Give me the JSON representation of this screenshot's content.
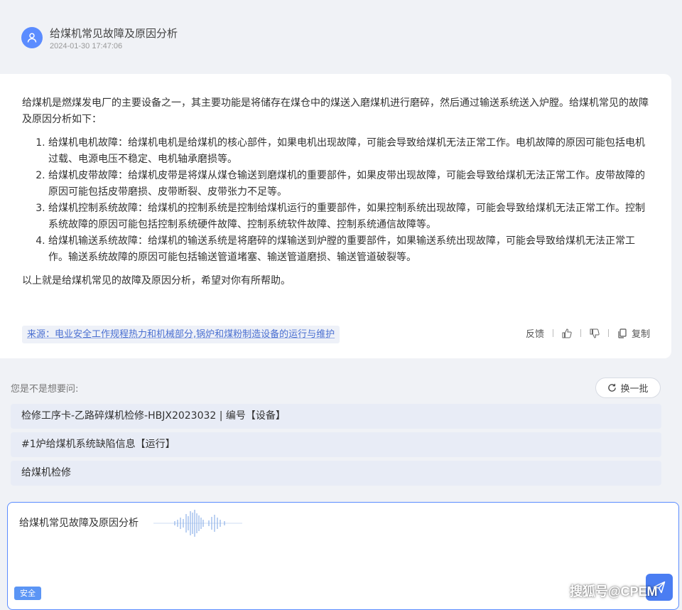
{
  "question": {
    "title": "给煤机常见故障及原因分析",
    "time": "2024-01-30 17:47:06",
    "avatar_icon": "user-icon"
  },
  "answer": {
    "intro": "给煤机是燃煤发电厂的主要设备之一，其主要功能是将储存在煤仓中的煤送入磨煤机进行磨碎，然后通过输送系统送入炉膛。给煤机常见的故障及原因分析如下：",
    "items": [
      "给煤机电机故障：给煤机电机是给煤机的核心部件，如果电机出现故障，可能会导致给煤机无法正常工作。电机故障的原因可能包括电机过载、电源电压不稳定、电机轴承磨损等。",
      "给煤机皮带故障：给煤机皮带是将煤从煤仓输送到磨煤机的重要部件，如果皮带出现故障，可能会导致给煤机无法正常工作。皮带故障的原因可能包括皮带磨损、皮带断裂、皮带张力不足等。",
      "给煤机控制系统故障：给煤机的控制系统是控制给煤机运行的重要部件，如果控制系统出现故障，可能会导致给煤机无法正常工作。控制系统故障的原因可能包括控制系统硬件故障、控制系统软件故障、控制系统通信故障等。",
      "给煤机输送系统故障：给煤机的输送系统是将磨碎的煤输送到炉膛的重要部件，如果输送系统出现故障，可能会导致给煤机无法正常工作。输送系统故障的原因可能包括输送管道堵塞、输送管道磨损、输送管道破裂等。"
    ],
    "outro": "以上就是给煤机常见的故障及原因分析，希望对你有所帮助。",
    "source": "来源：电业安全工作规程热力和机械部分,锅炉和煤粉制造设备的运行与维护",
    "actions": {
      "feedback": "反馈",
      "copy": "复制",
      "like_icon": "thumbs-up-icon",
      "dislike_icon": "thumbs-down-icon",
      "copy_icon": "copy-icon"
    }
  },
  "suggestions": {
    "label": "您是不是想要问:",
    "refresh": "换一批",
    "items": [
      "检修工序卡-乙路碎煤机检修-HBJX2023032 | 编号【设备】",
      "#1炉给煤机系统缺陷信息【运行】",
      "给煤机检修"
    ]
  },
  "input": {
    "value": "给煤机常见故障及原因分析",
    "badge": "安全",
    "send_icon": "send-icon"
  },
  "watermark": "搜狐号@CPEM",
  "colors": {
    "accent": "#5b8cff",
    "send": "#4a7df2",
    "link": "#4a6fd1",
    "background": "#f0f2f6"
  }
}
